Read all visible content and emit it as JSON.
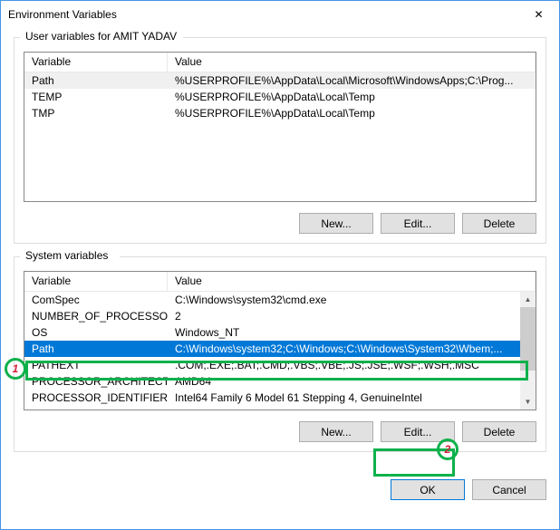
{
  "title": "Environment Variables",
  "user_section": {
    "legend": "User variables for AMIT YADAV",
    "columns": {
      "var": "Variable",
      "val": "Value"
    },
    "rows": [
      {
        "var": "Path",
        "val": "%USERPROFILE%\\AppData\\Local\\Microsoft\\WindowsApps;C:\\Prog..."
      },
      {
        "var": "TEMP",
        "val": "%USERPROFILE%\\AppData\\Local\\Temp"
      },
      {
        "var": "TMP",
        "val": "%USERPROFILE%\\AppData\\Local\\Temp"
      }
    ],
    "buttons": {
      "new": "New...",
      "edit": "Edit...",
      "delete": "Delete"
    }
  },
  "system_section": {
    "legend": "System variables",
    "columns": {
      "var": "Variable",
      "val": "Value"
    },
    "rows": [
      {
        "var": "ComSpec",
        "val": "C:\\Windows\\system32\\cmd.exe"
      },
      {
        "var": "NUMBER_OF_PROCESSORS",
        "val": "2"
      },
      {
        "var": "OS",
        "val": "Windows_NT"
      },
      {
        "var": "Path",
        "val": "C:\\Windows\\system32;C:\\Windows;C:\\Windows\\System32\\Wbem;..."
      },
      {
        "var": "PATHEXT",
        "val": ".COM;.EXE;.BAT;.CMD;.VBS;.VBE;.JS;.JSE;.WSF;.WSH;.MSC"
      },
      {
        "var": "PROCESSOR_ARCHITECTURE",
        "val": "AMD64"
      },
      {
        "var": "PROCESSOR_IDENTIFIER",
        "val": "Intel64 Family 6 Model 61 Stepping 4, GenuineIntel"
      }
    ],
    "buttons": {
      "new": "New...",
      "edit": "Edit...",
      "delete": "Delete"
    }
  },
  "dialog_buttons": {
    "ok": "OK",
    "cancel": "Cancel"
  },
  "markers": {
    "one": "1",
    "two": "2"
  }
}
